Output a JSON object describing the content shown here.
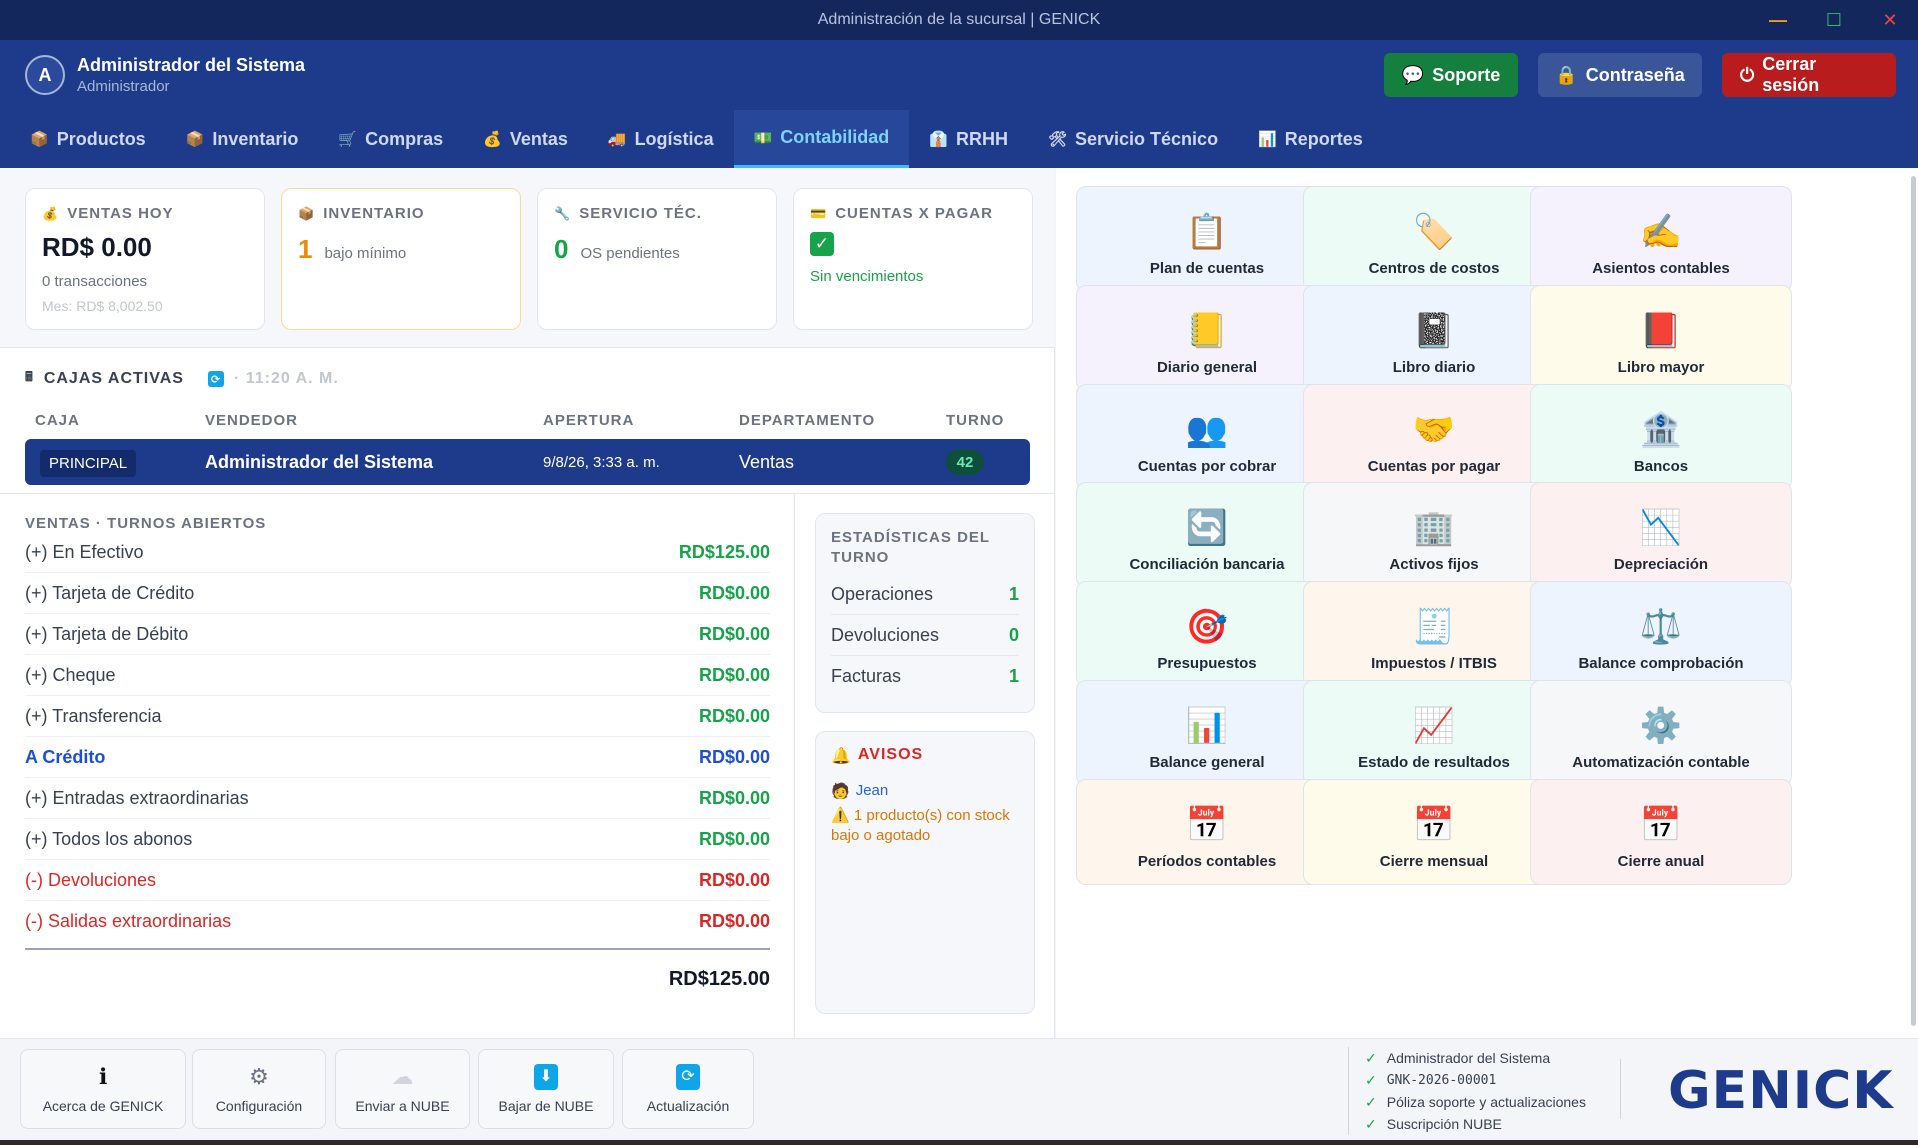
{
  "window": {
    "title": "Administración de la sucursal | GENICK"
  },
  "header": {
    "avatar_letter": "A",
    "user_name": "Administrador del Sistema",
    "user_role": "Administrador",
    "buttons": {
      "soporte": "Soporte",
      "password": "Contraseña",
      "logout": "Cerrar sesión"
    }
  },
  "nav": {
    "tabs": [
      {
        "label": "Productos",
        "icon": "📦"
      },
      {
        "label": "Inventario",
        "icon": "📦"
      },
      {
        "label": "Compras",
        "icon": "🛒"
      },
      {
        "label": "Ventas",
        "icon": "💰"
      },
      {
        "label": "Logística",
        "icon": "🚚"
      },
      {
        "label": "Contabilidad",
        "icon": "💵"
      },
      {
        "label": "RRHH",
        "icon": "👔"
      },
      {
        "label": "Servicio Técnico",
        "icon": "🛠"
      },
      {
        "label": "Reportes",
        "icon": "📊"
      }
    ],
    "active": "Contabilidad"
  },
  "stats": {
    "ventas_hoy": {
      "title": "VENTAS HOY",
      "value": "RD$ 0.00",
      "sub": "0 transacciones",
      "mes": "Mes: RD$ 8,002.50"
    },
    "inventario": {
      "title": "INVENTARIO",
      "value": "1",
      "desc": "bajo mínimo"
    },
    "servicio": {
      "title": "SERVICIO TÉC.",
      "value": "0",
      "desc": "OS pendientes"
    },
    "cuentas": {
      "title": "CUENTAS X PAGAR",
      "status": "Sin vencimientos"
    }
  },
  "cajas": {
    "title": "CAJAS ACTIVAS",
    "time": "· 11:20 A. M.",
    "columns": [
      "CAJA",
      "VENDEDOR",
      "APERTURA",
      "DEPARTAMENTO",
      "TURNO"
    ],
    "row": {
      "caja": "PRINCIPAL",
      "vendedor": "Administrador del Sistema",
      "apertura": "9/8/26, 3:33 a. m.",
      "departamento": "Ventas",
      "turno": "42"
    }
  },
  "ventas": {
    "title": "VENTAS · TURNOS ABIERTOS",
    "rows": [
      {
        "label": "(+) En Efectivo",
        "amount": "RD$125.00"
      },
      {
        "label": "(+) Tarjeta de Crédito",
        "amount": "RD$0.00"
      },
      {
        "label": "(+) Tarjeta de Débito",
        "amount": "RD$0.00"
      },
      {
        "label": "(+) Cheque",
        "amount": "RD$0.00"
      },
      {
        "label": "(+) Transferencia",
        "amount": "RD$0.00"
      },
      {
        "label": "A Crédito",
        "amount": "RD$0.00"
      },
      {
        "label": "(+) Entradas extraordinarias",
        "amount": "RD$0.00"
      },
      {
        "label": "(+) Todos los abonos",
        "amount": "RD$0.00"
      },
      {
        "label": "(-) Devoluciones",
        "amount": "RD$0.00"
      },
      {
        "label": "(-) Salidas extraordinarias",
        "amount": "RD$0.00"
      }
    ],
    "total": "RD$125.00"
  },
  "estadisticas": {
    "title": "ESTADÍSTICAS DEL TURNO",
    "rows": [
      {
        "label": "Operaciones",
        "value": "1"
      },
      {
        "label": "Devoluciones",
        "value": "0"
      },
      {
        "label": "Facturas",
        "value": "1"
      }
    ]
  },
  "avisos": {
    "title": "AVISOS",
    "user": "Jean",
    "message": "1 producto(s) con stock bajo o agotado"
  },
  "modules": [
    {
      "label": "Plan de cuentas",
      "icon": "📋",
      "color": "#eef4fd"
    },
    {
      "label": "Centros de costos",
      "icon": "🏷️",
      "color": "#edfbf6"
    },
    {
      "label": "Asientos contables",
      "icon": "✍️",
      "color": "#f6f2fd"
    },
    {
      "label": "Diario general",
      "icon": "📒",
      "color": "#f6f2fd"
    },
    {
      "label": "Libro diario",
      "icon": "📓",
      "color": "#eef4fd"
    },
    {
      "label": "Libro mayor",
      "icon": "📕",
      "color": "#fefbea"
    },
    {
      "label": "Cuentas por cobrar",
      "icon": "👥",
      "color": "#eef4fd"
    },
    {
      "label": "Cuentas por pagar",
      "icon": "🤝",
      "color": "#fdf0f1"
    },
    {
      "label": "Bancos",
      "icon": "🏦",
      "color": "#edfbf6"
    },
    {
      "label": "Conciliación bancaria",
      "icon": "🔄",
      "color": "#edfbf6"
    },
    {
      "label": "Activos fijos",
      "icon": "🏢",
      "color": "#f6f7f9"
    },
    {
      "label": "Depreciación",
      "icon": "📉",
      "color": "#fdf0f1"
    },
    {
      "label": "Presupuestos",
      "icon": "🎯",
      "color": "#edfbf6"
    },
    {
      "label": "Impuestos / ITBIS",
      "icon": "🧾",
      "color": "#fef5ec"
    },
    {
      "label": "Balance comprobación",
      "icon": "⚖️",
      "color": "#eef4fd"
    },
    {
      "label": "Balance general",
      "icon": "📊",
      "color": "#eef4fd"
    },
    {
      "label": "Estado de resultados",
      "icon": "📈",
      "color": "#edfbf6"
    },
    {
      "label": "Automatización contable",
      "icon": "⚙️",
      "color": "#f6f7f9"
    },
    {
      "label": "Períodos contables",
      "icon": "📅",
      "color": "#fef5ec"
    },
    {
      "label": "Cierre mensual",
      "icon": "📅",
      "color": "#fefbea"
    },
    {
      "label": "Cierre anual",
      "icon": "📅",
      "color": "#fdf0f1"
    }
  ],
  "footer": {
    "buttons": [
      {
        "label": "Acerca de GENICK",
        "icon": "ℹ"
      },
      {
        "label": "Configuración",
        "icon": "⚙"
      },
      {
        "label": "Enviar a NUBE",
        "icon": "☁"
      },
      {
        "label": "Bajar de NUBE",
        "icon": "⬇"
      },
      {
        "label": "Actualización",
        "icon": "🔄"
      }
    ],
    "license": [
      "Administrador del Sistema",
      "GNK-2026-00001",
      "Póliza soporte y actualizaciones",
      "Suscripción NUBE"
    ],
    "logo": "GENICK"
  },
  "colors": {
    "primary": "#1e3a8a",
    "success": "#16a34a",
    "danger": "#dc2626",
    "accent": "#38bdf8"
  }
}
